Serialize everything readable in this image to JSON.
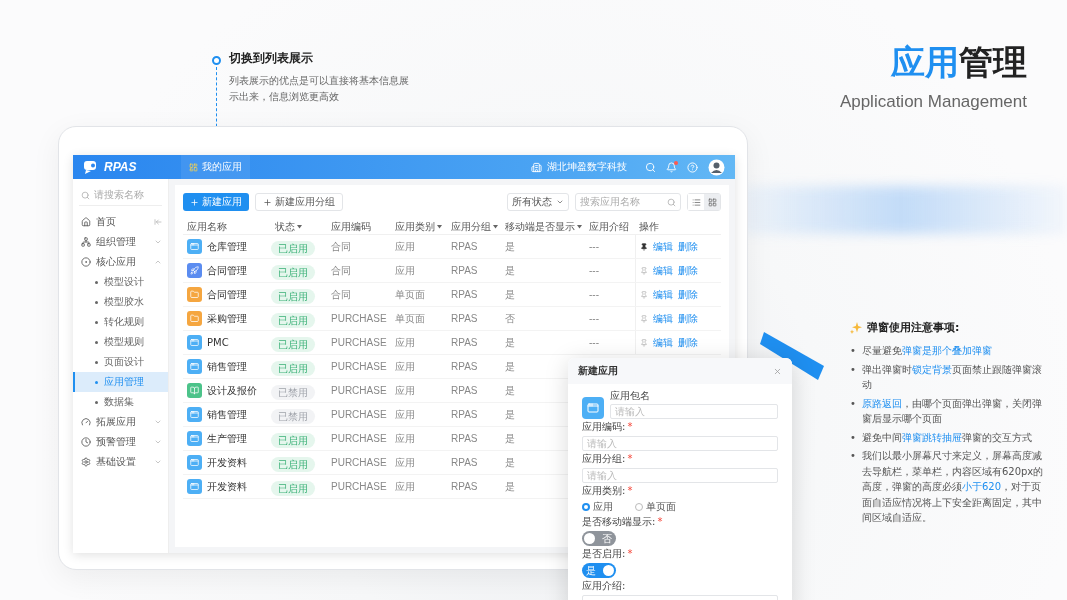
{
  "callout": {
    "title": "切换到列表展示",
    "description": "列表展示的优点是可以直接将基本信息展示出来，信息浏览更高效"
  },
  "heading": {
    "accent": "应用",
    "rest": "管理",
    "subtitle": "Application Management"
  },
  "app": {
    "logo": "RPAS",
    "nav_tab": "我的应用",
    "company": "湖北坤盈数字科技"
  },
  "sidebar": {
    "search_placeholder": "请搜索名称",
    "items": [
      {
        "label": "首页"
      },
      {
        "label": "组织管理",
        "expanded": false
      },
      {
        "label": "核心应用",
        "expanded": true,
        "children": [
          {
            "label": "模型设计",
            "selected": false
          },
          {
            "label": "模型胶水",
            "selected": false
          },
          {
            "label": "转化规则",
            "selected": false
          },
          {
            "label": "模型规则",
            "selected": false
          },
          {
            "label": "页面设计",
            "selected": false
          },
          {
            "label": "应用管理",
            "selected": true
          },
          {
            "label": "数据集",
            "selected": false
          }
        ]
      },
      {
        "label": "拓展应用",
        "expanded": false
      },
      {
        "label": "预警管理",
        "expanded": false
      },
      {
        "label": "基础设置",
        "expanded": false
      }
    ]
  },
  "toolbar": {
    "primary_button": "新建应用",
    "secondary_button": "新建应用分组",
    "status_select": "所有状态",
    "search_placeholder": "搜索应用名称",
    "views": [
      {
        "kind": "list",
        "selected": false
      },
      {
        "kind": "grid",
        "selected": true
      }
    ]
  },
  "table": {
    "columns": [
      {
        "label": "应用名称",
        "sortable": false
      },
      {
        "label": "状态",
        "sortable": true
      },
      {
        "label": "应用编码",
        "sortable": false
      },
      {
        "label": "应用类别",
        "sortable": true
      },
      {
        "label": "应用分组",
        "sortable": true
      },
      {
        "label": "移动端是否显示",
        "sortable": true
      },
      {
        "label": "应用介绍",
        "sortable": false
      },
      {
        "label": "操作",
        "sortable": false
      }
    ],
    "rows": [
      {
        "name": "仓库管理",
        "kind": "window",
        "color": "#4daff5",
        "status": "已启用",
        "enabled": true,
        "code": "合同",
        "type": "应用",
        "group": "RPAS",
        "mobile": "是",
        "intro": "---",
        "ops": {
          "pinned": true,
          "edit": "编辑",
          "delete": "删除"
        }
      },
      {
        "name": "合同管理",
        "kind": "rocket",
        "color": "#5b8cf0",
        "status": "已启用",
        "enabled": true,
        "code": "合同",
        "type": "应用",
        "group": "RPAS",
        "mobile": "是",
        "intro": "---",
        "ops": {
          "pinned": false,
          "edit": "编辑",
          "delete": "删除"
        }
      },
      {
        "name": "合同管理",
        "kind": "folder",
        "color": "#f5a640",
        "status": "已启用",
        "enabled": true,
        "code": "合同",
        "type": "单页面",
        "group": "RPAS",
        "mobile": "是",
        "intro": "---",
        "ops": {
          "pinned": false,
          "edit": "编辑",
          "delete": "删除"
        }
      },
      {
        "name": "采购管理",
        "kind": "folder",
        "color": "#f5a640",
        "status": "已启用",
        "enabled": true,
        "code": "PURCHASE",
        "type": "单页面",
        "group": "RPAS",
        "mobile": "否",
        "intro": "---",
        "ops": {
          "pinned": false,
          "edit": "编辑",
          "delete": "删除"
        }
      },
      {
        "name": "PMC",
        "kind": "window",
        "color": "#4daff5",
        "status": "已启用",
        "enabled": true,
        "code": "PURCHASE",
        "type": "应用",
        "group": "RPAS",
        "mobile": "是",
        "intro": "---",
        "ops": {
          "pinned": false,
          "edit": "编辑",
          "delete": "删除"
        }
      },
      {
        "name": "销售管理",
        "kind": "window",
        "color": "#4daff5",
        "status": "已启用",
        "enabled": true,
        "code": "PURCHASE",
        "type": "应用",
        "group": "RPAS",
        "mobile": "是"
      },
      {
        "name": "设计及报价",
        "kind": "book",
        "color": "#4cc38a",
        "status": "已禁用",
        "enabled": false,
        "code": "PURCHASE",
        "type": "应用",
        "group": "RPAS",
        "mobile": "是"
      },
      {
        "name": "销售管理",
        "kind": "window",
        "color": "#4daff5",
        "status": "已禁用",
        "enabled": false,
        "code": "PURCHASE",
        "type": "应用",
        "group": "RPAS",
        "mobile": "是"
      },
      {
        "name": "生产管理",
        "kind": "window",
        "color": "#4daff5",
        "status": "已启用",
        "enabled": true,
        "code": "PURCHASE",
        "type": "应用",
        "group": "RPAS",
        "mobile": "是"
      },
      {
        "name": "开发资料",
        "kind": "window",
        "color": "#4daff5",
        "status": "已启用",
        "enabled": true,
        "code": "PURCHASE",
        "type": "应用",
        "group": "RPAS",
        "mobile": "是"
      },
      {
        "name": "开发资料",
        "kind": "window",
        "color": "#4daff5",
        "status": "已启用",
        "enabled": true,
        "code": "PURCHASE",
        "type": "应用",
        "group": "RPAS",
        "mobile": "是"
      }
    ]
  },
  "modal": {
    "title": "新建应用",
    "package_label": "应用包名",
    "package_placeholder": "请输入",
    "fields": [
      {
        "kind": "text",
        "label": "应用编码:",
        "required": "*",
        "placeholder": "请输入"
      },
      {
        "kind": "text",
        "label": "应用分组:",
        "required": "*",
        "placeholder": "请输入"
      },
      {
        "kind": "radio",
        "label": "应用类别:",
        "required": "*",
        "options": [
          {
            "label": "应用",
            "selected": true
          },
          {
            "label": "单页面",
            "selected": false
          }
        ]
      },
      {
        "kind": "switch",
        "label": "是否移动端显示:",
        "required": "*",
        "on": false,
        "text": "否"
      },
      {
        "kind": "switch",
        "label": "是否启用:",
        "required": "*",
        "on": true,
        "text": "是"
      },
      {
        "kind": "textarea",
        "label": "应用介绍:"
      }
    ]
  },
  "notes": {
    "title": "弹窗使用注意事项:",
    "items": [
      {
        "bullet": "•",
        "segments": [
          {
            "text": "尽量避免",
            "highlight": false
          },
          {
            "text": "弹窗是那个叠加弹窗",
            "highlight": true
          }
        ]
      },
      {
        "bullet": "•",
        "segments": [
          {
            "text": "弹出弹窗时",
            "highlight": false
          },
          {
            "text": "锁定背景",
            "highlight": true
          },
          {
            "text": "页面禁止跟随弹窗滚动",
            "highlight": false
          }
        ]
      },
      {
        "bullet": "•",
        "segments": [
          {
            "text": "原路返回",
            "highlight": true
          },
          {
            "text": "，由哪个页面弹出弹窗，关闭弹窗后显示哪个页面",
            "highlight": false
          }
        ]
      },
      {
        "bullet": "•",
        "segments": [
          {
            "text": "避免中间",
            "highlight": false
          },
          {
            "text": "弹窗跳转抽屉",
            "highlight": true
          },
          {
            "text": "弹窗的交互方式",
            "highlight": false
          }
        ]
      },
      {
        "bullet": "•",
        "segments": [
          {
            "text": "我们以最小屏幕尺寸来定义，屏幕高度减去导航栏，菜单栏，内容区域有620px的高度，弹窗的高度必须",
            "highlight": false
          },
          {
            "text": "小于620",
            "highlight": true
          },
          {
            "text": "，对于页面自适应情况将上下安全距离固定，其中间区域自适应。",
            "highlight": false
          }
        ]
      }
    ]
  }
}
